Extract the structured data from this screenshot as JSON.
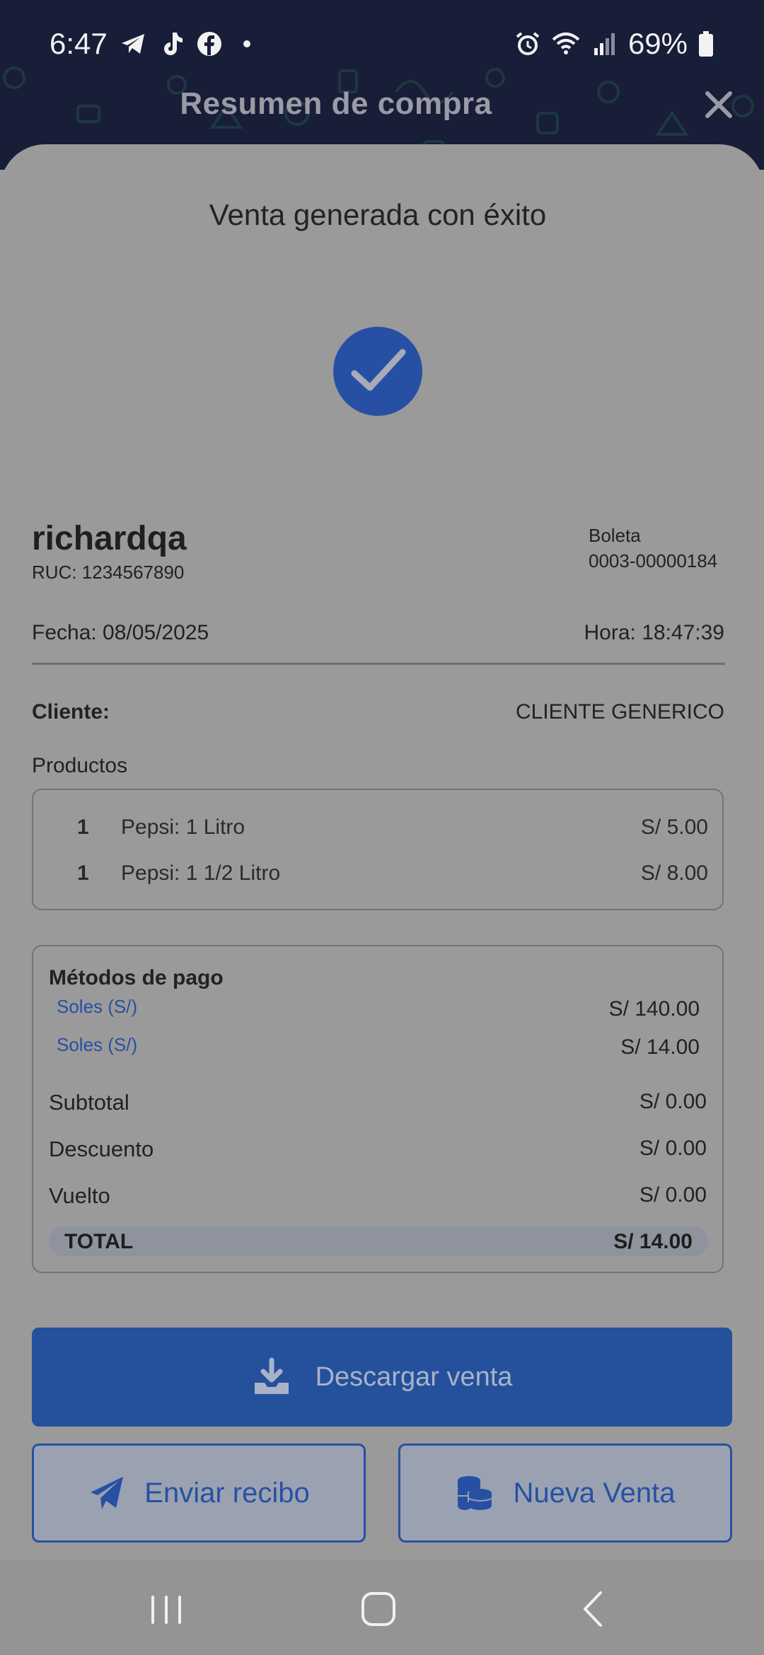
{
  "status_bar": {
    "time": "6:47",
    "battery": "69%",
    "left_icons": [
      "telegram-icon",
      "tiktok-icon",
      "facebook-icon",
      "notification-dot"
    ],
    "right_icons": [
      "alarm-icon",
      "wifi-icon",
      "signal-icon",
      "battery-icon"
    ]
  },
  "header": {
    "title": "Resumen de compra",
    "close_icon": "close-icon"
  },
  "sheet": {
    "heading": "Venta generada con éxito",
    "success_icon": "checkmark-icon",
    "company": "richardqa",
    "ruc": "RUC: 1234567890",
    "document_type": "Boleta",
    "document_number": "0003-00000184",
    "fecha": "Fecha: 08/05/2025",
    "hora": "Hora: 18:47:39",
    "cliente_label": "Cliente:",
    "cliente_value": "CLIENTE GENERICO",
    "productos_label": "Productos",
    "products": [
      {
        "qty": "1",
        "name": "Pepsi: 1 Litro",
        "price": "S/ 5.00"
      },
      {
        "qty": "1",
        "name": "Pepsi: 1 1/2 Litro",
        "price": "S/ 8.00"
      }
    ],
    "payment": {
      "title": "Métodos de pago",
      "methods": [
        {
          "name": "Soles (S/)",
          "amount": "S/ 140.00"
        },
        {
          "name": "Soles (S/)",
          "amount": "S/ 14.00"
        }
      ],
      "subtotal_label": "Subtotal",
      "subtotal_value": "S/ 0.00",
      "descuento_label": "Descuento",
      "descuento_value": "S/ 0.00",
      "vuelto_label": "Vuelto",
      "vuelto_value": "S/ 0.00",
      "total_label": "TOTAL",
      "total_value": "S/ 14.00"
    }
  },
  "actions": {
    "download_label": "Descargar venta",
    "download_icon": "download-icon",
    "send_label": "Enviar recibo",
    "send_icon": "paper-plane-icon",
    "new_sale_label": "Nueva Venta",
    "new_sale_icon": "coins-icon"
  },
  "navbar": {
    "recent_icon": "recent-apps-icon",
    "home_icon": "home-icon",
    "back_icon": "back-icon"
  },
  "colors": {
    "header_bg": "#181d38",
    "accent_blue": "#2750a4",
    "overlay_grey": "#9a9a9a"
  }
}
